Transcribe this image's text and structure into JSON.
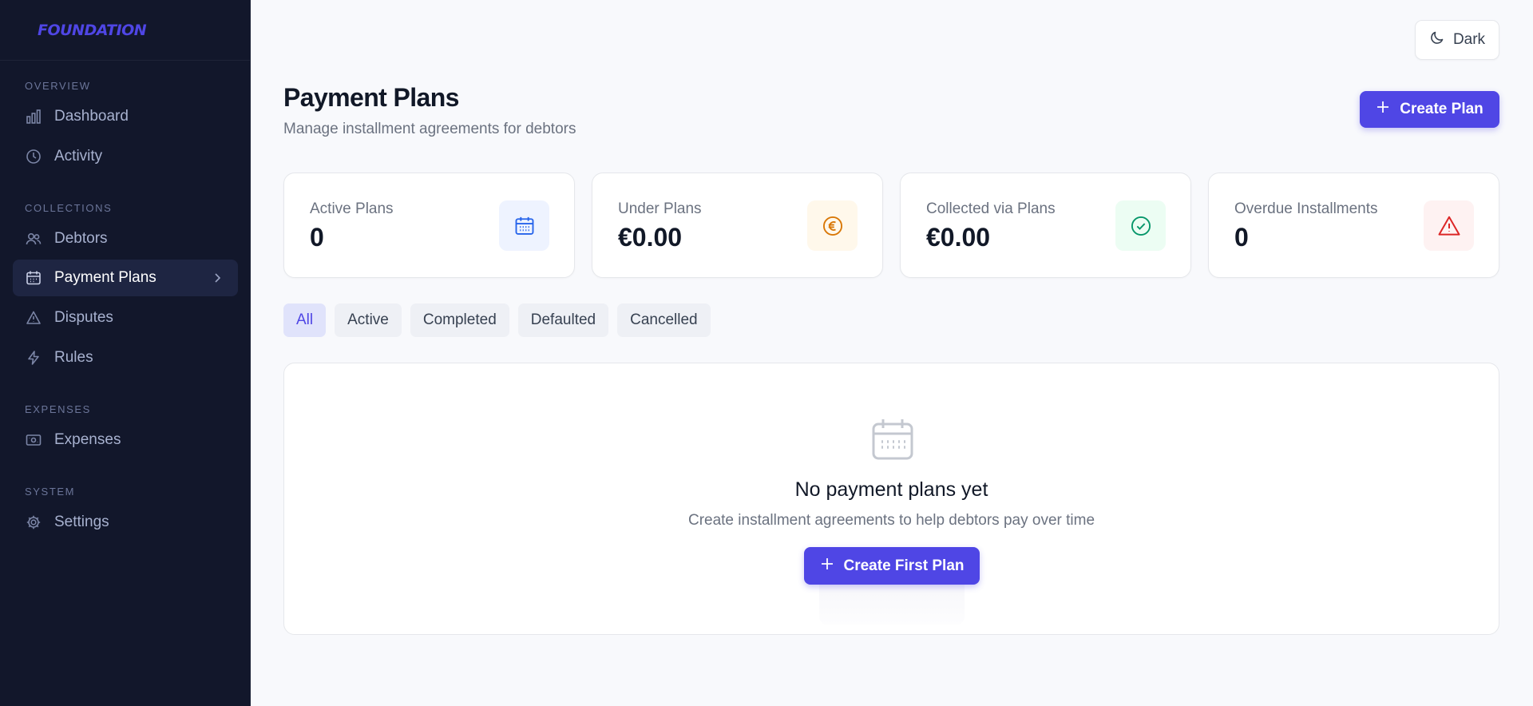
{
  "brand": "FOUNDATION",
  "sidebar": {
    "sections": [
      {
        "label": "OVERVIEW"
      },
      {
        "label": "COLLECTIONS"
      },
      {
        "label": "EXPENSES"
      },
      {
        "label": "SYSTEM"
      }
    ],
    "items": [
      {
        "label": "Dashboard",
        "icon": "bar-chart-icon"
      },
      {
        "label": "Activity",
        "icon": "clock-icon"
      },
      {
        "label": "Debtors",
        "icon": "users-icon"
      },
      {
        "label": "Payment Plans",
        "icon": "calendar-icon",
        "active": true
      },
      {
        "label": "Disputes",
        "icon": "warning-icon"
      },
      {
        "label": "Rules",
        "icon": "lightning-icon"
      },
      {
        "label": "Expenses",
        "icon": "receipt-icon"
      },
      {
        "label": "Settings",
        "icon": "gear-icon"
      }
    ]
  },
  "header": {
    "theme_toggle_label": "Dark",
    "title": "Payment Plans",
    "subtitle": "Manage installment agreements for debtors",
    "create_label": "Create Plan"
  },
  "stats": [
    {
      "label": "Active Plans",
      "value": "0",
      "icon": "calendar-icon",
      "color": "#2563eb",
      "bg": "#eef3ff"
    },
    {
      "label": "Under Plans",
      "value": "€0.00",
      "icon": "euro-icon",
      "color": "#d97706",
      "bg": "#fff8eb"
    },
    {
      "label": "Collected via Plans",
      "value": "€0.00",
      "icon": "check-circle-icon",
      "color": "#059669",
      "bg": "#ecfdf3"
    },
    {
      "label": "Overdue Installments",
      "value": "0",
      "icon": "alert-triangle-icon",
      "color": "#dc2626",
      "bg": "#fef2f2"
    }
  ],
  "filters": [
    "All",
    "Active",
    "Completed",
    "Defaulted",
    "Cancelled"
  ],
  "active_filter": "All",
  "empty_state": {
    "title": "No payment plans yet",
    "subtitle": "Create installment agreements to help debtors pay over time",
    "button_label": "Create First Plan"
  },
  "colors": {
    "accent": "#4f46e5",
    "sidebar_bg": "#12172b"
  }
}
